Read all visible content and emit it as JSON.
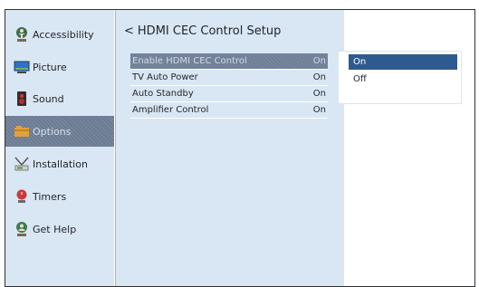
{
  "sidebar": {
    "items": [
      {
        "label": "Accessibility",
        "icon": "accessibility-icon"
      },
      {
        "label": "Picture",
        "icon": "picture-icon"
      },
      {
        "label": "Sound",
        "icon": "speaker-icon"
      },
      {
        "label": "Options",
        "icon": "options-icon"
      },
      {
        "label": "Installation",
        "icon": "antenna-icon"
      },
      {
        "label": "Timers",
        "icon": "timer-icon"
      },
      {
        "label": "Get Help",
        "icon": "help-icon"
      }
    ],
    "selected_index": 3
  },
  "main": {
    "back_glyph": "<",
    "title": "HDMI CEC Control Setup",
    "rows": [
      {
        "label": "Enable HDMI CEC Control",
        "value": "On"
      },
      {
        "label": "TV Auto Power",
        "value": "On"
      },
      {
        "label": "Auto Standby",
        "value": "On"
      },
      {
        "label": "Amplifier Control",
        "value": "On"
      }
    ],
    "selected_row": 0
  },
  "popup": {
    "options": [
      "On",
      "Off"
    ],
    "selected_index": 0
  },
  "colors": {
    "panel_bg": "#d9e6f3",
    "selection": "#6b7c93",
    "popup_highlight": "#2f5a8f"
  }
}
